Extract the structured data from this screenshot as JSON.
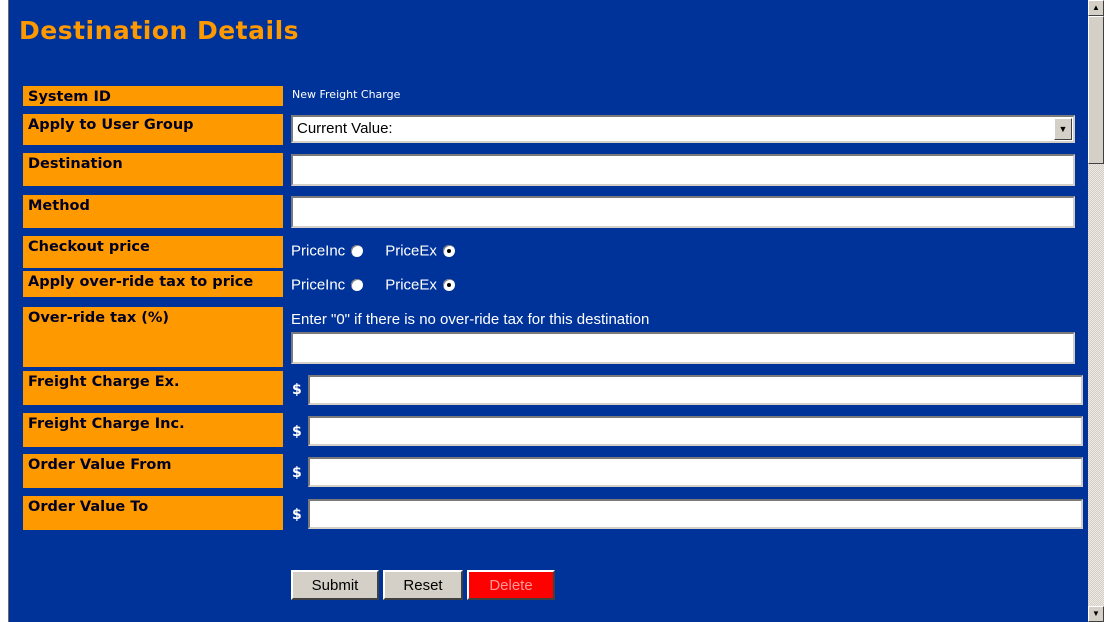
{
  "page": {
    "title": "Destination Details"
  },
  "fields": {
    "system_id": {
      "label": "System ID",
      "value": "New Freight Charge"
    },
    "user_group": {
      "label": "Apply to User Group",
      "selected": "Current Value:"
    },
    "destination": {
      "label": "Destination",
      "value": ""
    },
    "method": {
      "label": "Method",
      "value": ""
    },
    "checkout_price": {
      "label": "Checkout price",
      "option1": "PriceInc",
      "option2": "PriceEx",
      "selected": "PriceEx"
    },
    "override_apply": {
      "label": "Apply over-ride tax to price",
      "option1": "PriceInc",
      "option2": "PriceEx",
      "selected": "PriceEx"
    },
    "override_tax": {
      "label": "Over-ride tax (%)",
      "hint": "Enter \"0\" if there is no over-ride tax for this destination",
      "value": ""
    },
    "freight_ex": {
      "label": "Freight Charge Ex.",
      "currency": "$",
      "value": ""
    },
    "freight_inc": {
      "label": "Freight Charge Inc.",
      "currency": "$",
      "value": ""
    },
    "order_from": {
      "label": "Order Value From",
      "currency": "$",
      "value": ""
    },
    "order_to": {
      "label": "Order Value To",
      "currency": "$",
      "value": ""
    }
  },
  "buttons": {
    "submit": "Submit",
    "reset": "Reset",
    "delete": "Delete"
  },
  "colors": {
    "background": "#003399",
    "label_bg": "#ff9900",
    "title": "#ff9900",
    "delete_bg": "#ff0000"
  },
  "icons": {
    "select_arrow": "chevron-down-icon",
    "scroll_up": "scroll-up-arrow-icon",
    "scroll_down": "scroll-down-arrow-icon"
  }
}
